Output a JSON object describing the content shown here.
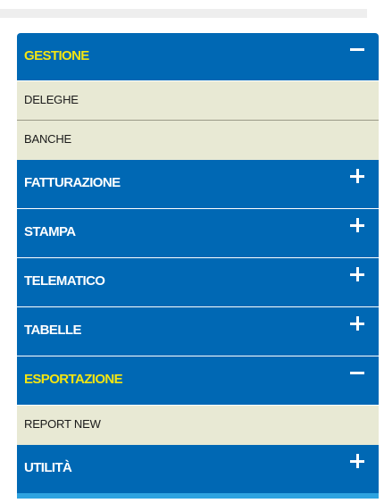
{
  "menu": {
    "sections": [
      {
        "label": "GESTIONE",
        "expanded": true,
        "toggle": "minus",
        "items": [
          "DELEGHE",
          "BANCHE"
        ]
      },
      {
        "label": "FATTURAZIONE",
        "expanded": false,
        "toggle": "plus",
        "items": []
      },
      {
        "label": "STAMPA",
        "expanded": false,
        "toggle": "plus",
        "items": []
      },
      {
        "label": "TELEMATICO",
        "expanded": false,
        "toggle": "plus",
        "items": []
      },
      {
        "label": "TABELLE",
        "expanded": false,
        "toggle": "plus",
        "items": []
      },
      {
        "label": "ESPORTAZIONE",
        "expanded": true,
        "toggle": "minus",
        "items": [
          "REPORT NEW"
        ]
      },
      {
        "label": "UTILITÀ",
        "expanded": false,
        "toggle": "plus",
        "items": []
      }
    ]
  },
  "colors": {
    "header_bg": "#0068b4",
    "header_text": "#ffffff",
    "expanded_text": "#f3e512",
    "item_bg": "#e8e9d4",
    "item_text": "#1a1a1a",
    "bottom_strip": "#2ea3e0",
    "top_bar": "#eeeeee"
  }
}
